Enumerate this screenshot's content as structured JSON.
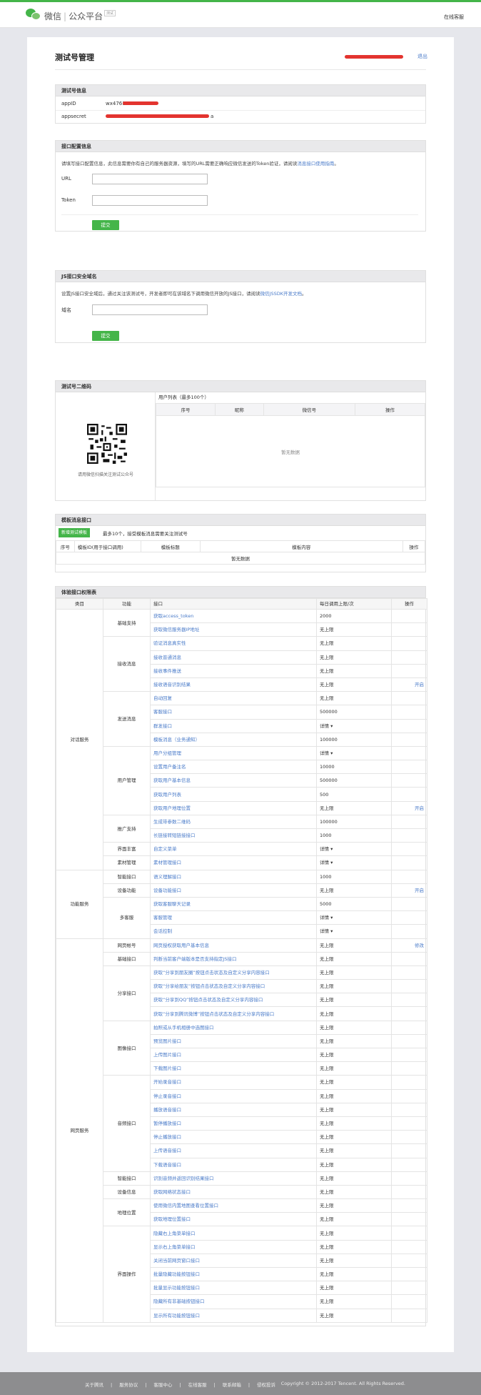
{
  "header": {
    "logo": "chat-bubble-icon",
    "brand1": "微信",
    "brand2": "公众平台",
    "right": "在线客服"
  },
  "page": {
    "title": "测试号管理",
    "logout": "退出"
  },
  "account": {
    "title": "测试号信息",
    "appid_label": "appID",
    "appid_value": "wx4761",
    "secret_label": "appsecret",
    "secret_value": "a"
  },
  "iface": {
    "title": "接口配置信息",
    "desc_pre": "请填写接口配置信息，此信息需要你有自己的服务器资源，填写的URL需要正确响应微信发送的Token验证，请阅读",
    "desc_link": "消息接口使用指南",
    "desc_post": "。",
    "url_label": "URL",
    "token_label": "Token",
    "submit": "提交"
  },
  "js": {
    "title": "JS接口安全域名",
    "desc_pre": "设置JS接口安全域后，通过关注该测试号，开发者即可在该域名下调用微信开放的JS接口，请阅读",
    "desc_link": "微信JSSDK开发文档",
    "desc_post": "。",
    "domain_label": "域名",
    "submit": "提交"
  },
  "qrcode": {
    "title": "测试号二维码",
    "caption": "请用微信扫描关注测试公众号",
    "list_title": "用户列表（最多100个）",
    "cols": [
      "序号",
      "昵称",
      "微信号",
      "操作"
    ],
    "empty": "暂无数据"
  },
  "tmpl": {
    "title": "模板消息接口",
    "add_btn": "新增测试模板",
    "note": "最多10个，接受模板消息需要关注测试号",
    "cols": [
      "序号",
      "模板ID(用于接口调用)",
      "模板标题",
      "模板内容",
      "操作"
    ],
    "empty": "暂无数据"
  },
  "perm": {
    "title": "体验接口权限表",
    "cols": [
      "类目",
      "功能",
      "接口",
      "每日调用上限/次",
      "操作"
    ],
    "rows": [
      [
        "对话服务",
        "基础支持",
        "获取access_token",
        "2000",
        ""
      ],
      [
        "",
        "",
        "获取微信服务器IP地址",
        "无上限",
        ""
      ],
      [
        "",
        "接收消息",
        "验证消息真实性",
        "无上限",
        ""
      ],
      [
        "",
        "",
        "接收普通消息",
        "无上限",
        ""
      ],
      [
        "",
        "",
        "接收事件推送",
        "无上限",
        ""
      ],
      [
        "",
        "",
        "接收语音识别结果",
        "无上限",
        "开启"
      ],
      [
        "",
        "发送消息",
        "自动回复",
        "无上限",
        ""
      ],
      [
        "",
        "",
        "客服接口",
        "500000",
        ""
      ],
      [
        "",
        "",
        "群发接口",
        "详情 ▾",
        ""
      ],
      [
        "",
        "",
        "模板消息（业务通知）",
        "100000",
        ""
      ],
      [
        "",
        "用户管理",
        "用户分组管理",
        "详情 ▾",
        ""
      ],
      [
        "",
        "",
        "设置用户备注名",
        "10000",
        ""
      ],
      [
        "",
        "",
        "获取用户基本信息",
        "500000",
        ""
      ],
      [
        "",
        "",
        "获取用户列表",
        "500",
        ""
      ],
      [
        "",
        "",
        "获取用户地理位置",
        "无上限",
        "开启"
      ],
      [
        "",
        "推广支持",
        "生成带参数二维码",
        "100000",
        ""
      ],
      [
        "",
        "",
        "长链接转短链接接口",
        "1000",
        ""
      ],
      [
        "",
        "界面丰富",
        "自定义菜单",
        "详情 ▾",
        ""
      ],
      [
        "",
        "素材管理",
        "素材管理接口",
        "详情 ▾",
        ""
      ],
      [
        "功能服务",
        "智能接口",
        "语义理解接口",
        "1000",
        ""
      ],
      [
        "",
        "设备功能",
        "设备功能接口",
        "无上限",
        "开启"
      ],
      [
        "",
        "多客服",
        "获取客服聊天记录",
        "5000",
        ""
      ],
      [
        "",
        "",
        "客服管理",
        "详情 ▾",
        ""
      ],
      [
        "",
        "",
        "会话控制",
        "详情 ▾",
        ""
      ],
      [
        "网页服务",
        "网页帐号",
        "网页授权获取用户基本信息",
        "无上限",
        "修改"
      ],
      [
        "",
        "基础接口",
        "判断当前客户端版本是否支持指定JS接口",
        "无上限",
        ""
      ],
      [
        "",
        "分享接口",
        "获取“分享到朋友圈”按钮点击状态及自定义分享内容接口",
        "无上限",
        ""
      ],
      [
        "",
        "",
        "获取“分享给朋友”按钮点击状态及自定义分享内容接口",
        "无上限",
        ""
      ],
      [
        "",
        "",
        "获取“分享到QQ”按钮点击状态及自定义分享内容接口",
        "无上限",
        ""
      ],
      [
        "",
        "",
        "获取“分享到腾讯微博”按钮点击状态及自定义分享内容接口",
        "无上限",
        ""
      ],
      [
        "",
        "图像接口",
        "拍照或从手机相册中选图接口",
        "无上限",
        ""
      ],
      [
        "",
        "",
        "预览图片接口",
        "无上限",
        ""
      ],
      [
        "",
        "",
        "上传图片接口",
        "无上限",
        ""
      ],
      [
        "",
        "",
        "下载图片接口",
        "无上限",
        ""
      ],
      [
        "",
        "音频接口",
        "开始录音接口",
        "无上限",
        ""
      ],
      [
        "",
        "",
        "停止录音接口",
        "无上限",
        ""
      ],
      [
        "",
        "",
        "播放语音接口",
        "无上限",
        ""
      ],
      [
        "",
        "",
        "暂停播放接口",
        "无上限",
        ""
      ],
      [
        "",
        "",
        "停止播放接口",
        "无上限",
        ""
      ],
      [
        "",
        "",
        "上传语音接口",
        "无上限",
        ""
      ],
      [
        "",
        "",
        "下载语音接口",
        "无上限",
        ""
      ],
      [
        "",
        "智能接口",
        "识别音频并返回识别结果接口",
        "无上限",
        ""
      ],
      [
        "",
        "设备信息",
        "获取网络状态接口",
        "无上限",
        ""
      ],
      [
        "",
        "地理位置",
        "使用微信内置地图查看位置接口",
        "无上限",
        ""
      ],
      [
        "",
        "",
        "获取地理位置接口",
        "无上限",
        ""
      ],
      [
        "",
        "界面操作",
        "隐藏右上角菜单接口",
        "无上限",
        ""
      ],
      [
        "",
        "",
        "显示右上角菜单接口",
        "无上限",
        ""
      ],
      [
        "",
        "",
        "关闭当前网页窗口接口",
        "无上限",
        ""
      ],
      [
        "",
        "",
        "批量隐藏功能按钮接口",
        "无上限",
        ""
      ],
      [
        "",
        "",
        "批量显示功能按钮接口",
        "无上限",
        ""
      ],
      [
        "",
        "",
        "隐藏所有非基础按钮接口",
        "无上限",
        ""
      ],
      [
        "",
        "",
        "显示所有功能按钮接口",
        "无上限",
        ""
      ]
    ],
    "spans": {
      "cat": [
        [
          0,
          19
        ],
        [
          19,
          5
        ],
        [
          24,
          28
        ]
      ],
      "func": [
        [
          0,
          2
        ],
        [
          2,
          4
        ],
        [
          6,
          4
        ],
        [
          10,
          5
        ],
        [
          15,
          2
        ],
        [
          17,
          1
        ],
        [
          18,
          1
        ],
        [
          19,
          1
        ],
        [
          20,
          1
        ],
        [
          21,
          3
        ],
        [
          24,
          1
        ],
        [
          25,
          1
        ],
        [
          26,
          4
        ],
        [
          30,
          4
        ],
        [
          34,
          7
        ],
        [
          41,
          1
        ],
        [
          42,
          1
        ],
        [
          43,
          2
        ],
        [
          45,
          7
        ]
      ]
    }
  },
  "footer": {
    "links": [
      "关于腾讯",
      "服务协议",
      "客服中心",
      "在线客服",
      "联系邮箱",
      "侵权投诉"
    ],
    "copyright": "Copyright © 2012-2017 Tencent. All Rights Reserved."
  }
}
